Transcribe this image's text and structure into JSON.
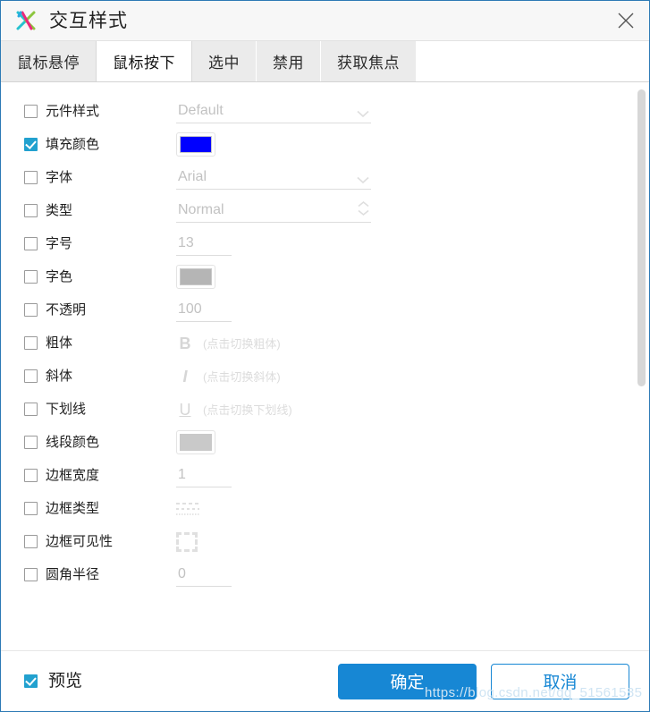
{
  "window": {
    "title": "交互样式",
    "logo_icon": "axure-x-logo-icon",
    "close_icon": "close-icon",
    "accent_color": "#1787d4",
    "checkbox_color": "#22a1cf"
  },
  "tabs": [
    {
      "label": "鼠标悬停",
      "active": false
    },
    {
      "label": "鼠标按下",
      "active": true
    },
    {
      "label": "选中",
      "active": false
    },
    {
      "label": "禁用",
      "active": false
    },
    {
      "label": "获取焦点",
      "active": false
    }
  ],
  "rows": [
    {
      "label": "元件样式",
      "checked": false,
      "control": "select",
      "value": "Default",
      "icon": "chevron-down-icon"
    },
    {
      "label": "填充颜色",
      "checked": true,
      "control": "color",
      "value": "#0000ff"
    },
    {
      "label": "字体",
      "checked": false,
      "control": "select",
      "value": "Arial",
      "icon": "chevron-down-icon"
    },
    {
      "label": "类型",
      "checked": false,
      "control": "spinner",
      "value": "Normal",
      "icon": "spinner-arrows-icon"
    },
    {
      "label": "字号",
      "checked": false,
      "control": "number",
      "value": "13"
    },
    {
      "label": "字色",
      "checked": false,
      "control": "color",
      "value": "#b5b5b5"
    },
    {
      "label": "不透明",
      "checked": false,
      "control": "number",
      "value": "100"
    },
    {
      "label": "粗体",
      "checked": false,
      "control": "glyph",
      "value": "B",
      "glyph_style": "bold",
      "hint": "(点击切换粗体)",
      "icon": "bold-icon"
    },
    {
      "label": "斜体",
      "checked": false,
      "control": "glyph",
      "value": "I",
      "glyph_style": "italic",
      "hint": "(点击切换斜体)",
      "icon": "italic-icon"
    },
    {
      "label": "下划线",
      "checked": false,
      "control": "glyph",
      "value": "U",
      "glyph_style": "under",
      "hint": "(点击切换下划线)",
      "icon": "underline-icon"
    },
    {
      "label": "线段颜色",
      "checked": false,
      "control": "color",
      "value": "#c9c9c9"
    },
    {
      "label": "边框宽度",
      "checked": false,
      "control": "number",
      "value": "1"
    },
    {
      "label": "边框类型",
      "checked": false,
      "control": "linestyle",
      "value": "",
      "icon": "line-style-icon"
    },
    {
      "label": "边框可见性",
      "checked": false,
      "control": "boxicon",
      "value": "",
      "icon": "border-visibility-icon"
    },
    {
      "label": "圆角半径",
      "checked": false,
      "control": "number",
      "value": "0"
    }
  ],
  "scrollbar": {
    "name": "vertical-scrollbar"
  },
  "footer": {
    "preview_label": "预览",
    "preview_checked": true,
    "ok_label": "确定",
    "cancel_label": "取消"
  },
  "watermark": "https://blog.csdn.net/qq_51561585"
}
